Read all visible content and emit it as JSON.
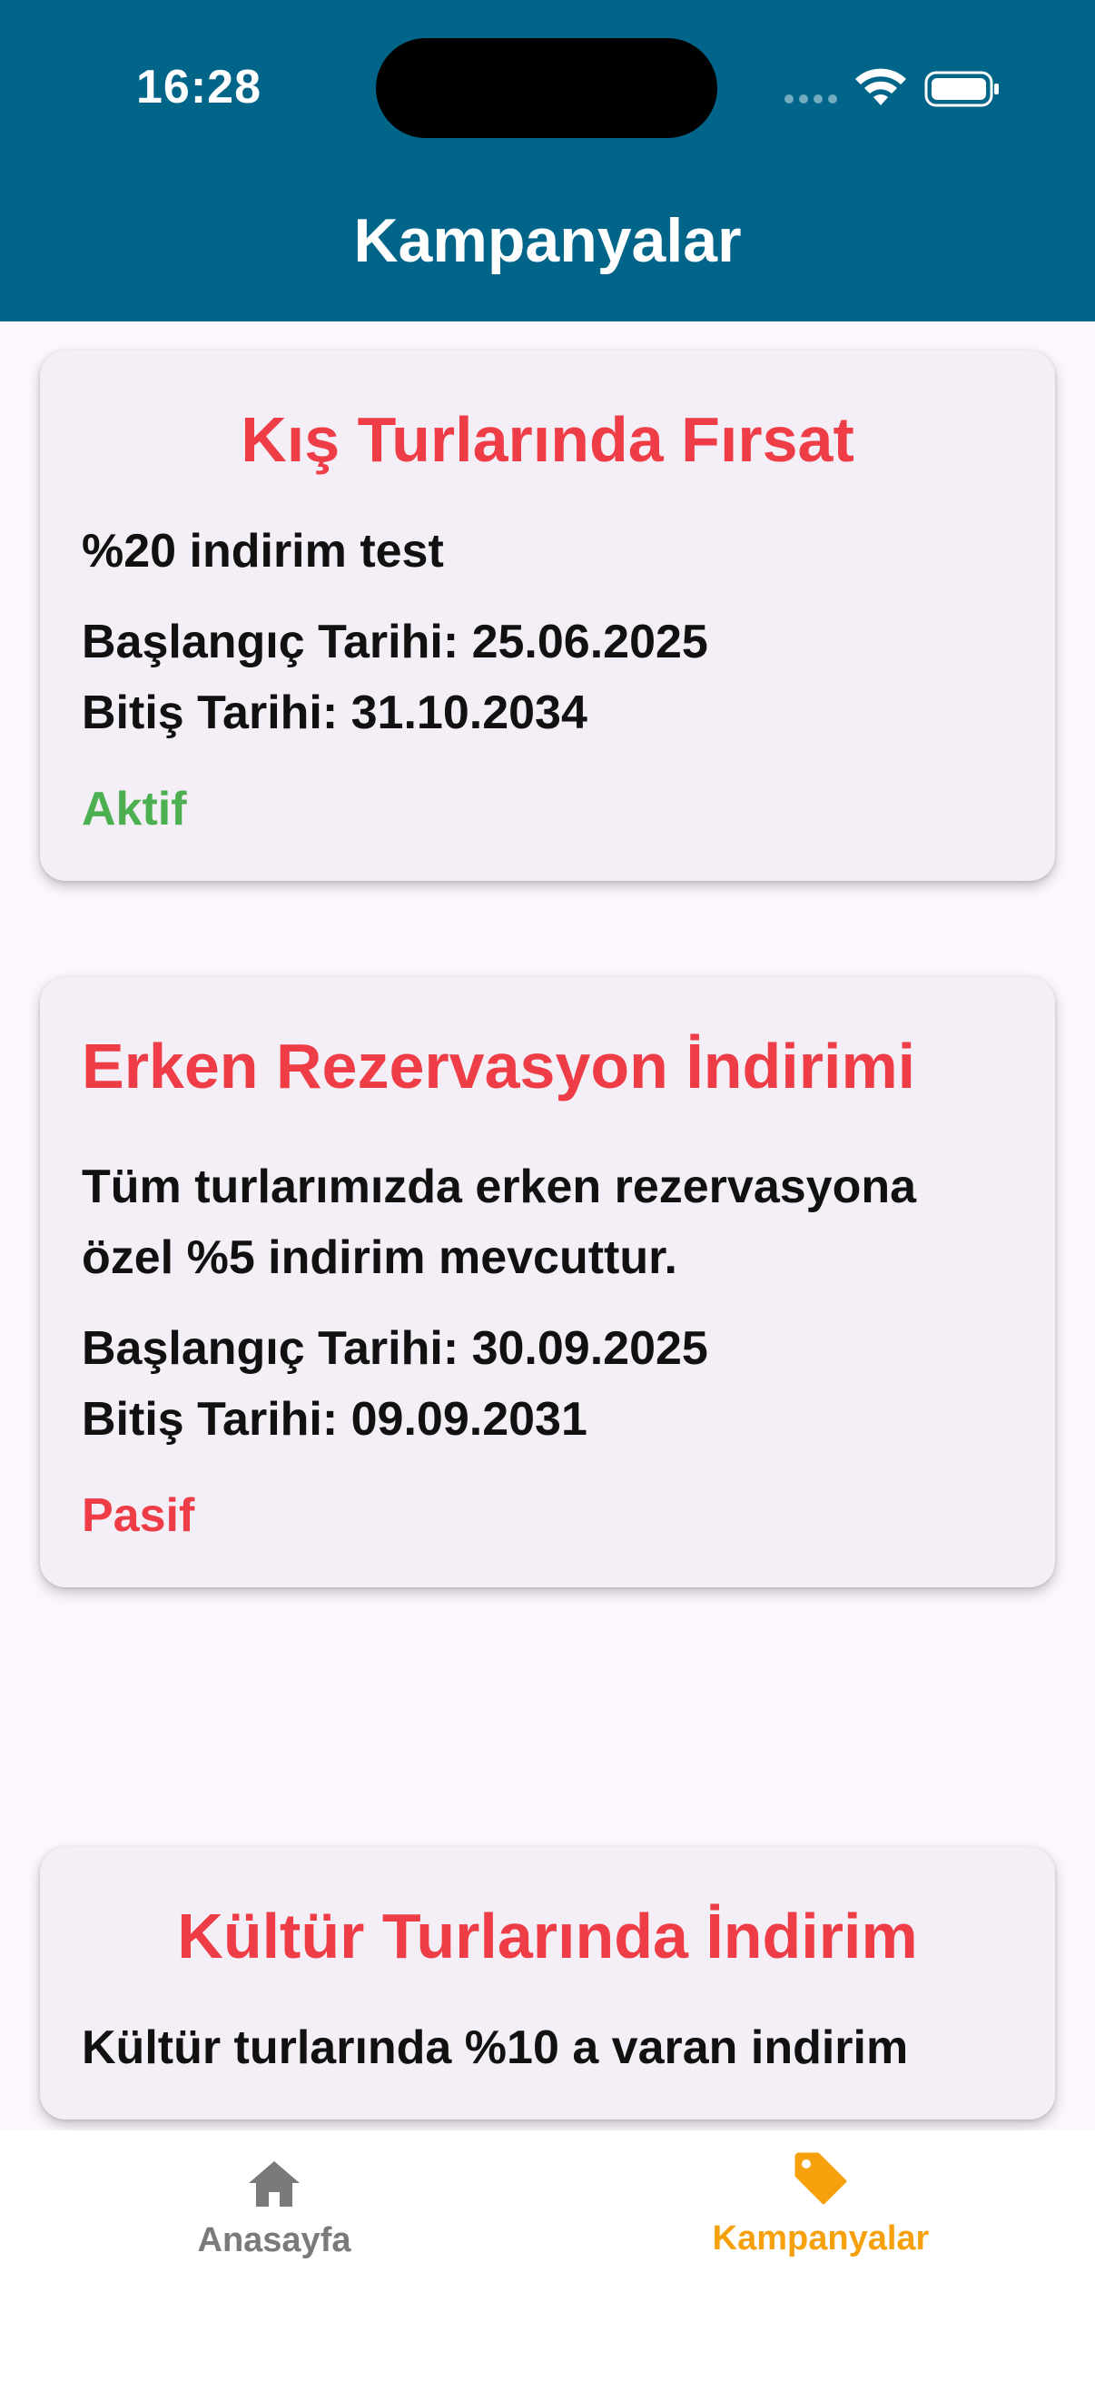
{
  "status_bar": {
    "time": "16:28"
  },
  "header": {
    "title": "Kampanyalar"
  },
  "campaigns": [
    {
      "title": "Kış Turlarında Fırsat",
      "description": "%20 indirim test",
      "start": "Başlangıç Tarihi: 25.06.2025",
      "end": "Bitiş Tarihi: 31.10.2034",
      "status": "Aktif"
    },
    {
      "title": "Erken Rezervasyon İndirimi",
      "description": "Tüm turlarımızda erken rezervasyona özel %5 indirim mevcuttur.",
      "start": "Başlangıç Tarihi: 30.09.2025",
      "end": "Bitiş Tarihi: 09.09.2031",
      "status": "Pasif"
    },
    {
      "title": "Kültür Turlarında İndirim",
      "description": "Kültür turlarında %10 a varan indirim"
    }
  ],
  "tabbar": {
    "home": {
      "label": "Anasayfa",
      "icon": "home-icon"
    },
    "campaigns": {
      "label": "Kampanyalar",
      "icon": "tag-icon"
    }
  },
  "colors": {
    "header": "#016489",
    "title_red": "#ee3d47",
    "active_green": "#4caf50",
    "inactive_red": "#ee3d47",
    "tab_selected": "#f6a10c",
    "tab_unselected": "#7a7a7a"
  }
}
